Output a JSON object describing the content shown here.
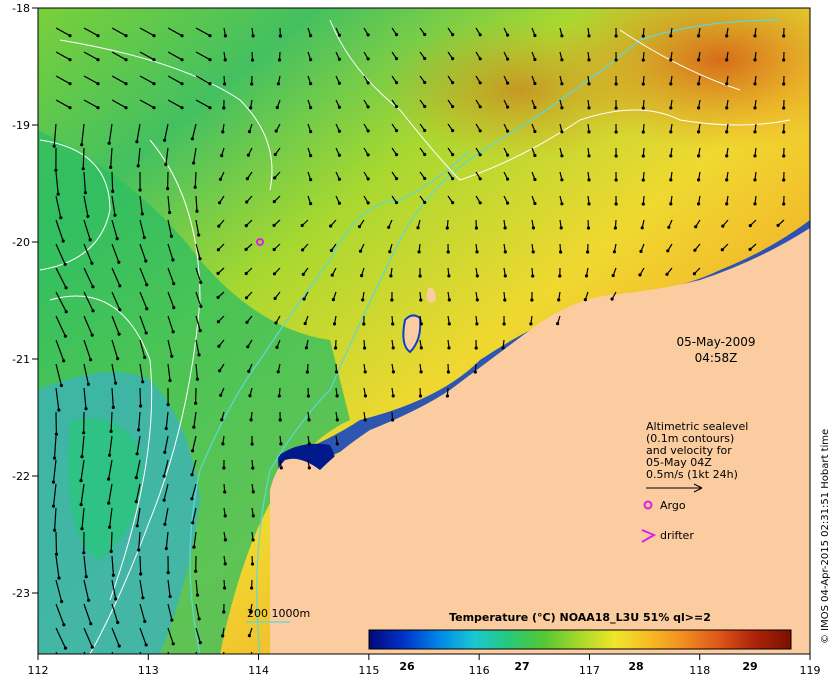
{
  "map": {
    "date": "05-May-2009",
    "time": "04:58Z",
    "credit": "© IMOS 04-Apr-2015 02:31:51 Hobart time",
    "x_ticks": [
      "112",
      "113",
      "114",
      "115",
      "116",
      "117",
      "118",
      "119"
    ],
    "y_ticks": [
      "-18",
      "-19",
      "-20",
      "-21",
      "-22",
      "-23"
    ],
    "legend": {
      "lines": [
        "Altimetric sealevel",
        "(0.1m contours)",
        "and velocity for",
        "05-May 04Z",
        "0.5m/s (1kt 24h)"
      ],
      "argo_label": "Argo",
      "drifter_label": "drifter",
      "bathy_label": "200  1000m"
    },
    "colorbar": {
      "title": "Temperature (°C) NOAA18_L3U 51% ql>=2",
      "ticks": [
        "26",
        "27",
        "28",
        "29"
      ],
      "colors": [
        "#00087a",
        "#0033c8",
        "#0088e8",
        "#19c8d0",
        "#28c878",
        "#55c832",
        "#a8d82c",
        "#f0e62a",
        "#f7ba24",
        "#f08a20",
        "#dc5418",
        "#aa2208",
        "#7a1000"
      ]
    },
    "colors": {
      "land": "#fbcca0",
      "contour": "#ffffff",
      "bathymetry": "#5cd8d8",
      "arrow": "#000000",
      "marker": "#e020e0"
    }
  }
}
